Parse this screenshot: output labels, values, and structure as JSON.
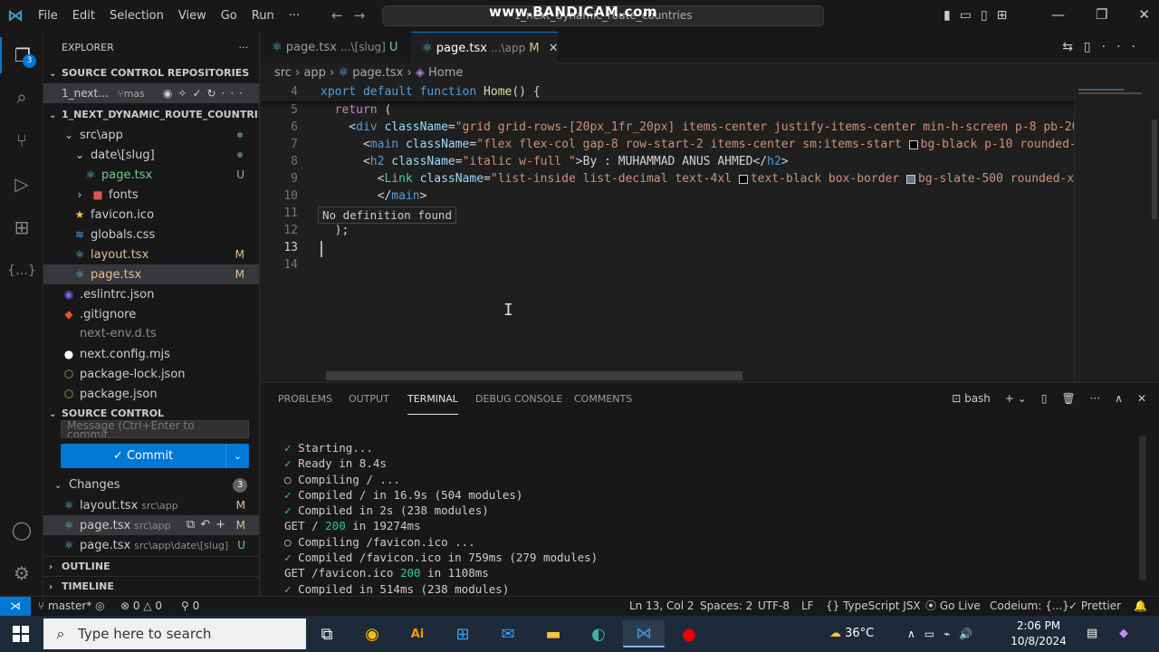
{
  "titlebar": {
    "menu": [
      "File",
      "Edit",
      "Selection",
      "View",
      "Go",
      "Run",
      "···"
    ],
    "command_center": "1_next_dynamic_route_countries",
    "watermark": "www.BANDICAM.com"
  },
  "activitybar": {
    "explorer_badge": "3"
  },
  "explorer": {
    "title": "EXPLORER",
    "repos_header": "SOURCE CONTROL REPOSITORIES",
    "repo_name": "1_next...",
    "repo_branch": "mas",
    "project_header": "1_NEXT_DYNAMIC_ROUTE_COUNTRIES",
    "tree": [
      {
        "label": "src\\app",
        "type": "folder-open",
        "indent": 1
      },
      {
        "label": "date\\[slug]",
        "type": "folder-open",
        "indent": 2
      },
      {
        "label": "page.tsx",
        "type": "react",
        "indent": 3,
        "status": "U"
      },
      {
        "label": "fonts",
        "type": "folder",
        "indent": 2
      },
      {
        "label": "favicon.ico",
        "type": "star",
        "indent": 2
      },
      {
        "label": "globals.css",
        "type": "css",
        "indent": 2
      },
      {
        "label": "layout.tsx",
        "type": "react",
        "indent": 2,
        "status": "M"
      },
      {
        "label": "page.tsx",
        "type": "react",
        "indent": 2,
        "status": "M"
      },
      {
        "label": ".eslintrc.json",
        "type": "eslint",
        "indent": 1
      },
      {
        "label": ".gitignore",
        "type": "git",
        "indent": 1
      },
      {
        "label": "next-env.d.ts",
        "type": "ts",
        "indent": 1
      },
      {
        "label": "next.config.mjs",
        "type": "next",
        "indent": 1
      },
      {
        "label": "package-lock.json",
        "type": "npm",
        "indent": 1
      },
      {
        "label": "package.json",
        "type": "npm",
        "indent": 1
      }
    ],
    "sc_header": "SOURCE CONTROL",
    "message_placeholder": "Message (Ctrl+Enter to commit...",
    "commit_label": "Commit",
    "changes_label": "Changes",
    "changes_count": "3",
    "changes": [
      {
        "name": "layout.tsx",
        "path": "src\\app",
        "status": "M"
      },
      {
        "name": "page.tsx",
        "path": "src\\app",
        "status": "M"
      },
      {
        "name": "page.tsx",
        "path": "src\\app\\date\\[slug]",
        "status": "U"
      }
    ],
    "outline_header": "OUTLINE",
    "timeline_header": "TIMELINE"
  },
  "tabs": [
    {
      "name": "page.tsx",
      "desc": "...\\[slug]",
      "status": "U",
      "active": false
    },
    {
      "name": "page.tsx",
      "desc": "...\\app",
      "status": "M",
      "active": true
    }
  ],
  "breadcrumb": [
    "src",
    "app",
    "page.tsx",
    "Home"
  ],
  "editor": {
    "lines": [
      "4",
      "5",
      "6",
      "7",
      "8",
      "9",
      "10",
      "11",
      "12",
      "13",
      "14"
    ],
    "tooltip": "No definition found"
  },
  "panel": {
    "tabs": [
      "PROBLEMS",
      "OUTPUT",
      "TERMINAL",
      "DEBUG CONSOLE",
      "COMMENTS"
    ],
    "active_tab": "TERMINAL",
    "shell": "bash",
    "terminal": [
      {
        "mark": "✓",
        "text": "Starting..."
      },
      {
        "mark": "✓",
        "text": "Ready in 8.4s"
      },
      {
        "mark": "○",
        "text": "Compiling / ..."
      },
      {
        "mark": "✓",
        "text": "Compiled / in 16.9s (504 modules)"
      },
      {
        "mark": "✓",
        "text": "Compiled in 2s (238 modules)"
      },
      {
        "mark": "",
        "text": "GET / ",
        "code": "200",
        "rest": " in 19274ms"
      },
      {
        "mark": "○",
        "text": "Compiling /favicon.ico ..."
      },
      {
        "mark": "✓",
        "text": "Compiled /favicon.ico in 759ms (279 modules)"
      },
      {
        "mark": "",
        "text": "GET /favicon.ico ",
        "code": "200",
        "rest": " in 1108ms"
      },
      {
        "mark": "✓",
        "text": "Compiled in 514ms (238 modules)"
      }
    ]
  },
  "statusbar": {
    "branch": "master*",
    "errors": "0",
    "warnings": "0",
    "ports": "0",
    "position": "Ln 13, Col 2",
    "spaces": "Spaces: 2",
    "encoding": "UTF-8",
    "eol": "LF",
    "language": "TypeScript JSX",
    "golive": "Go Live",
    "codeium": "Codeium: {...}",
    "prettier": "Prettier"
  },
  "taskbar": {
    "search_placeholder": "Type here to search",
    "weather": "36°C",
    "time": "2:06 PM",
    "date": "10/8/2024"
  }
}
